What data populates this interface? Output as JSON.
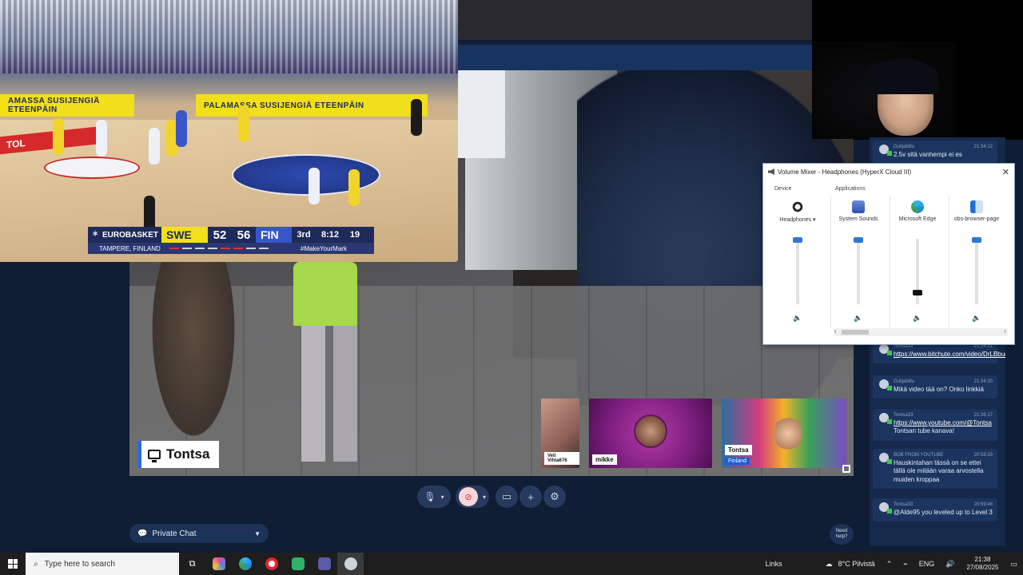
{
  "game": {
    "banner_left": "AMASSA  SUSIJENGIÄ  ETEENPÄIN",
    "banner_center": "PALAMASSA  SUSIJENGIÄ  ETEENPÄIN",
    "floor_ad": "TOL",
    "scoreboard": {
      "brand": "EUROBASKET",
      "team1": "SWE",
      "score1": "52",
      "score2": "56",
      "team2": "FIN",
      "quarter": "3rd",
      "clock": "8:12",
      "shot_clock": "19",
      "location": "TAMPERE, FINLAND",
      "hashtag": "#MakeYourMark"
    }
  },
  "main_stream": {
    "presenter_name": "Tontsa"
  },
  "participants": [
    {
      "name": "Veli Vihta676"
    },
    {
      "name": "mikke"
    },
    {
      "name": "Tontsa",
      "sub": "Finland"
    }
  ],
  "volume_mixer": {
    "title": "Volume Mixer - Headphones (HyperX Cloud III)",
    "device_section": "Device",
    "apps_section": "Applications",
    "columns": [
      {
        "label": "Headphones ▾",
        "icon": "headphones-icon",
        "level": 1.0
      },
      {
        "label": "System Sounds",
        "icon": "system-sounds-icon",
        "level": 1.0
      },
      {
        "label": "Microsoft Edge",
        "icon": "edge-icon",
        "level": 0.2
      },
      {
        "label": "obs-browser-page",
        "icon": "obs-browser-icon",
        "level": 1.0
      }
    ]
  },
  "chat": {
    "messages": [
      {
        "user": "Gulljabillu",
        "time": "21:34:12",
        "text": "2.5v sitä vanhempi ei es"
      },
      {
        "user": "Tontsa33",
        "time": "21:34:51",
        "link": "https://www.bitchute.com/video/DrLBbuoQQl30",
        "text": ""
      },
      {
        "user": "Gulljabillu",
        "time": "21:34:20",
        "text": "Mikä video tää on? Onko linkkiä"
      },
      {
        "user": "Tontsa33",
        "time": "21:36:17",
        "link": "https://www.youtube.com/@Tontsa",
        "text": "Tontsan tube kanava!"
      },
      {
        "user": "BOB FROM YOUTUBE",
        "time": "20:58:33",
        "text": "Hauskintahan tässä on se ettei tällä ole mitään varaa arvostella muiden kroppaa"
      },
      {
        "user": "Tontsa33",
        "time": "20:59:46",
        "text": "@Alde95 you leveled up to Level 3"
      }
    ]
  },
  "controls": {
    "private_chat": "Private Chat",
    "need_help": "Need help?"
  },
  "taskbar": {
    "search_placeholder": "Type here to search",
    "links": "Links",
    "weather": "8°C  Pilvistä",
    "lang": "ENG",
    "time": "21:38",
    "date": "27/08/2025"
  }
}
